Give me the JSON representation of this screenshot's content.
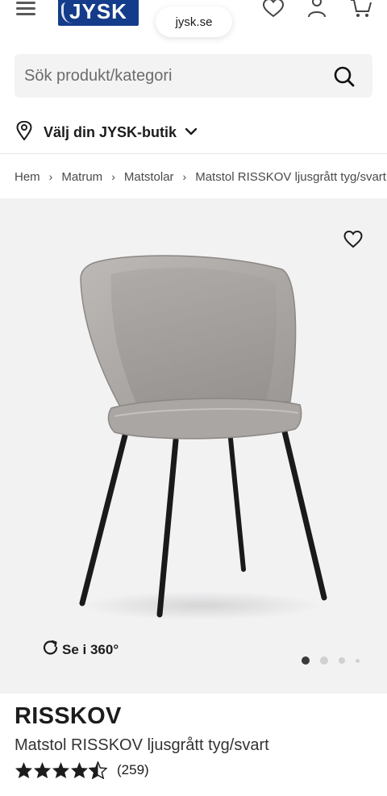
{
  "browser": {
    "url": "jysk.se"
  },
  "header": {
    "logo_text": "JYSK",
    "brand_color": "#143c8a"
  },
  "search": {
    "placeholder": "Sök produkt/kategori"
  },
  "store": {
    "label": "Välj din JYSK-butik"
  },
  "breadcrumb": [
    "Hem",
    "Matrum",
    "Matstolar",
    "Matstol RISSKOV ljusgrått tyg/svart"
  ],
  "gallery": {
    "see360_label": "Se i 360°",
    "image_count": 4,
    "active_image": 1
  },
  "product": {
    "name": "RISSKOV",
    "description": "Matstol RISSKOV ljusgrått tyg/svart",
    "rating": 4.5,
    "review_count": "(259)"
  }
}
